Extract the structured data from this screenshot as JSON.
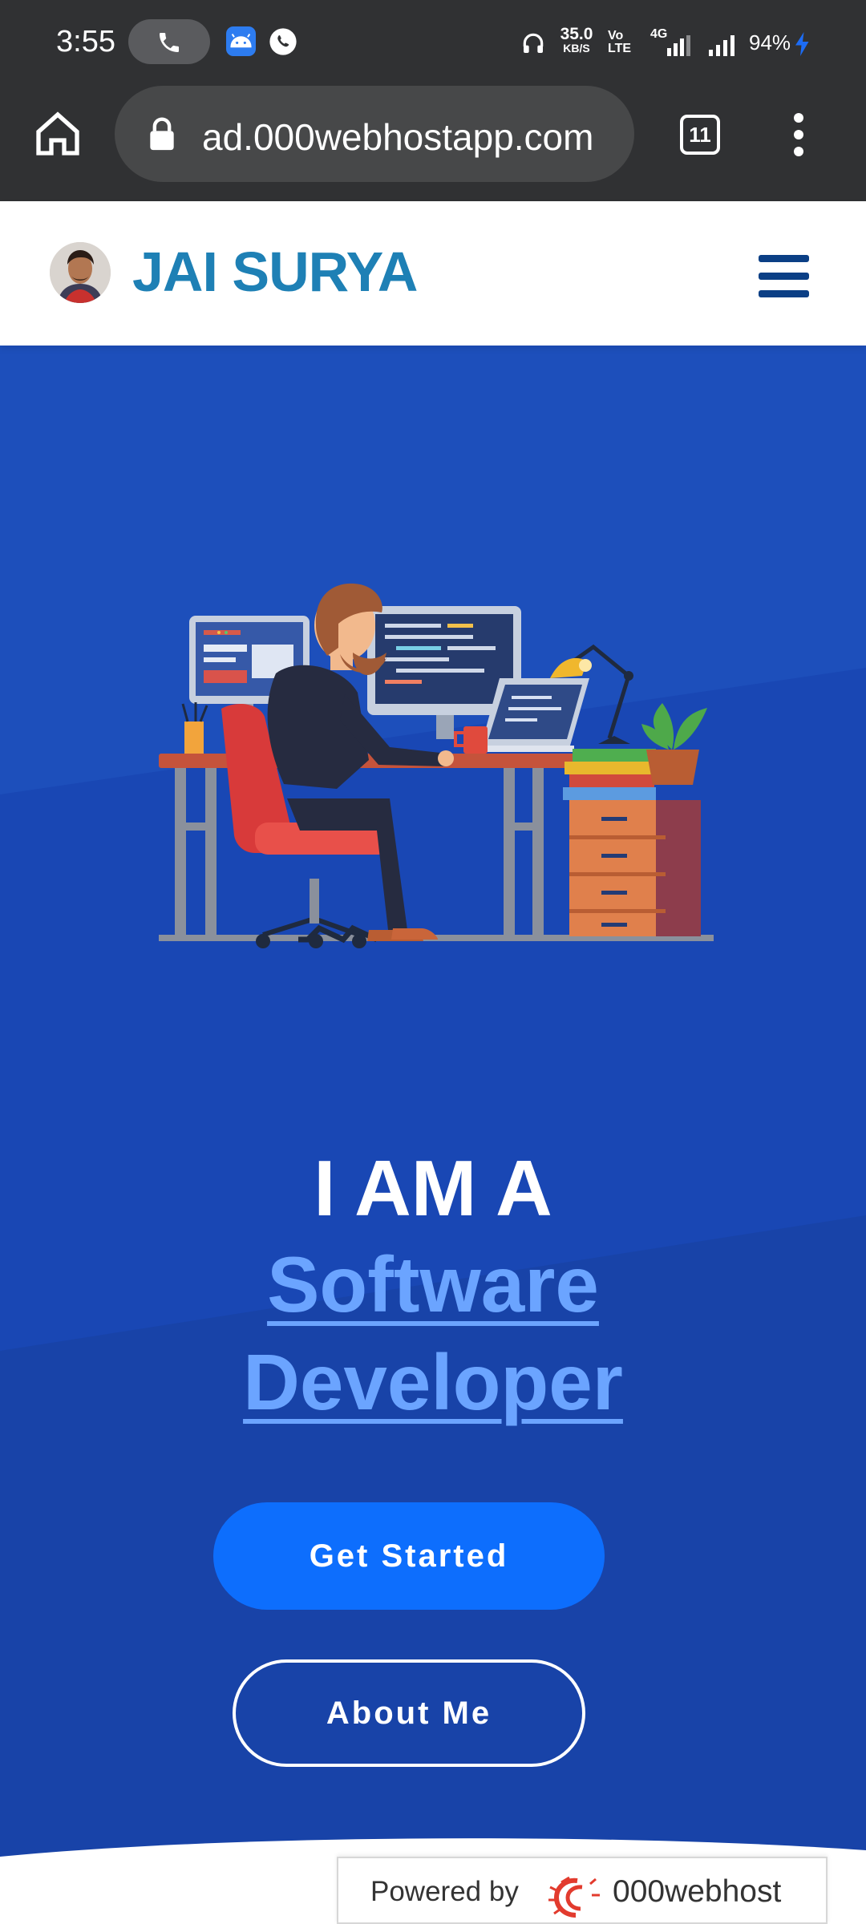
{
  "statusbar": {
    "time": "3:55",
    "netspeed_value": "35.0",
    "netspeed_unit": "KB/S",
    "volte_line1": "Vo",
    "volte_line2": "LTE",
    "network_label": "4G",
    "battery": "94%",
    "icons": [
      "phone-call-icon",
      "android-notification-icon",
      "whatsapp-icon",
      "headphones-icon",
      "signal-icon",
      "battery-charging-icon"
    ]
  },
  "browser": {
    "url": "ad.000webhostapp.com",
    "tab_count": "11",
    "icons": [
      "home-icon",
      "lock-icon",
      "tab-switcher-icon",
      "overflow-menu-icon"
    ]
  },
  "site": {
    "brand": "JAI SURYA",
    "colors": {
      "brand": "#1e80b5",
      "menu": "#0b3f85",
      "hero_bg": "#1947b4",
      "accent": "#6ba4ff",
      "button": "#0d6efd"
    }
  },
  "hero": {
    "title": "I AM A",
    "role_line1": "Software",
    "role_line2": "Developer",
    "primary_button": "Get Started",
    "secondary_button": "About Me"
  },
  "footer_badge": {
    "text": "Powered by",
    "brand": "000webhost"
  }
}
